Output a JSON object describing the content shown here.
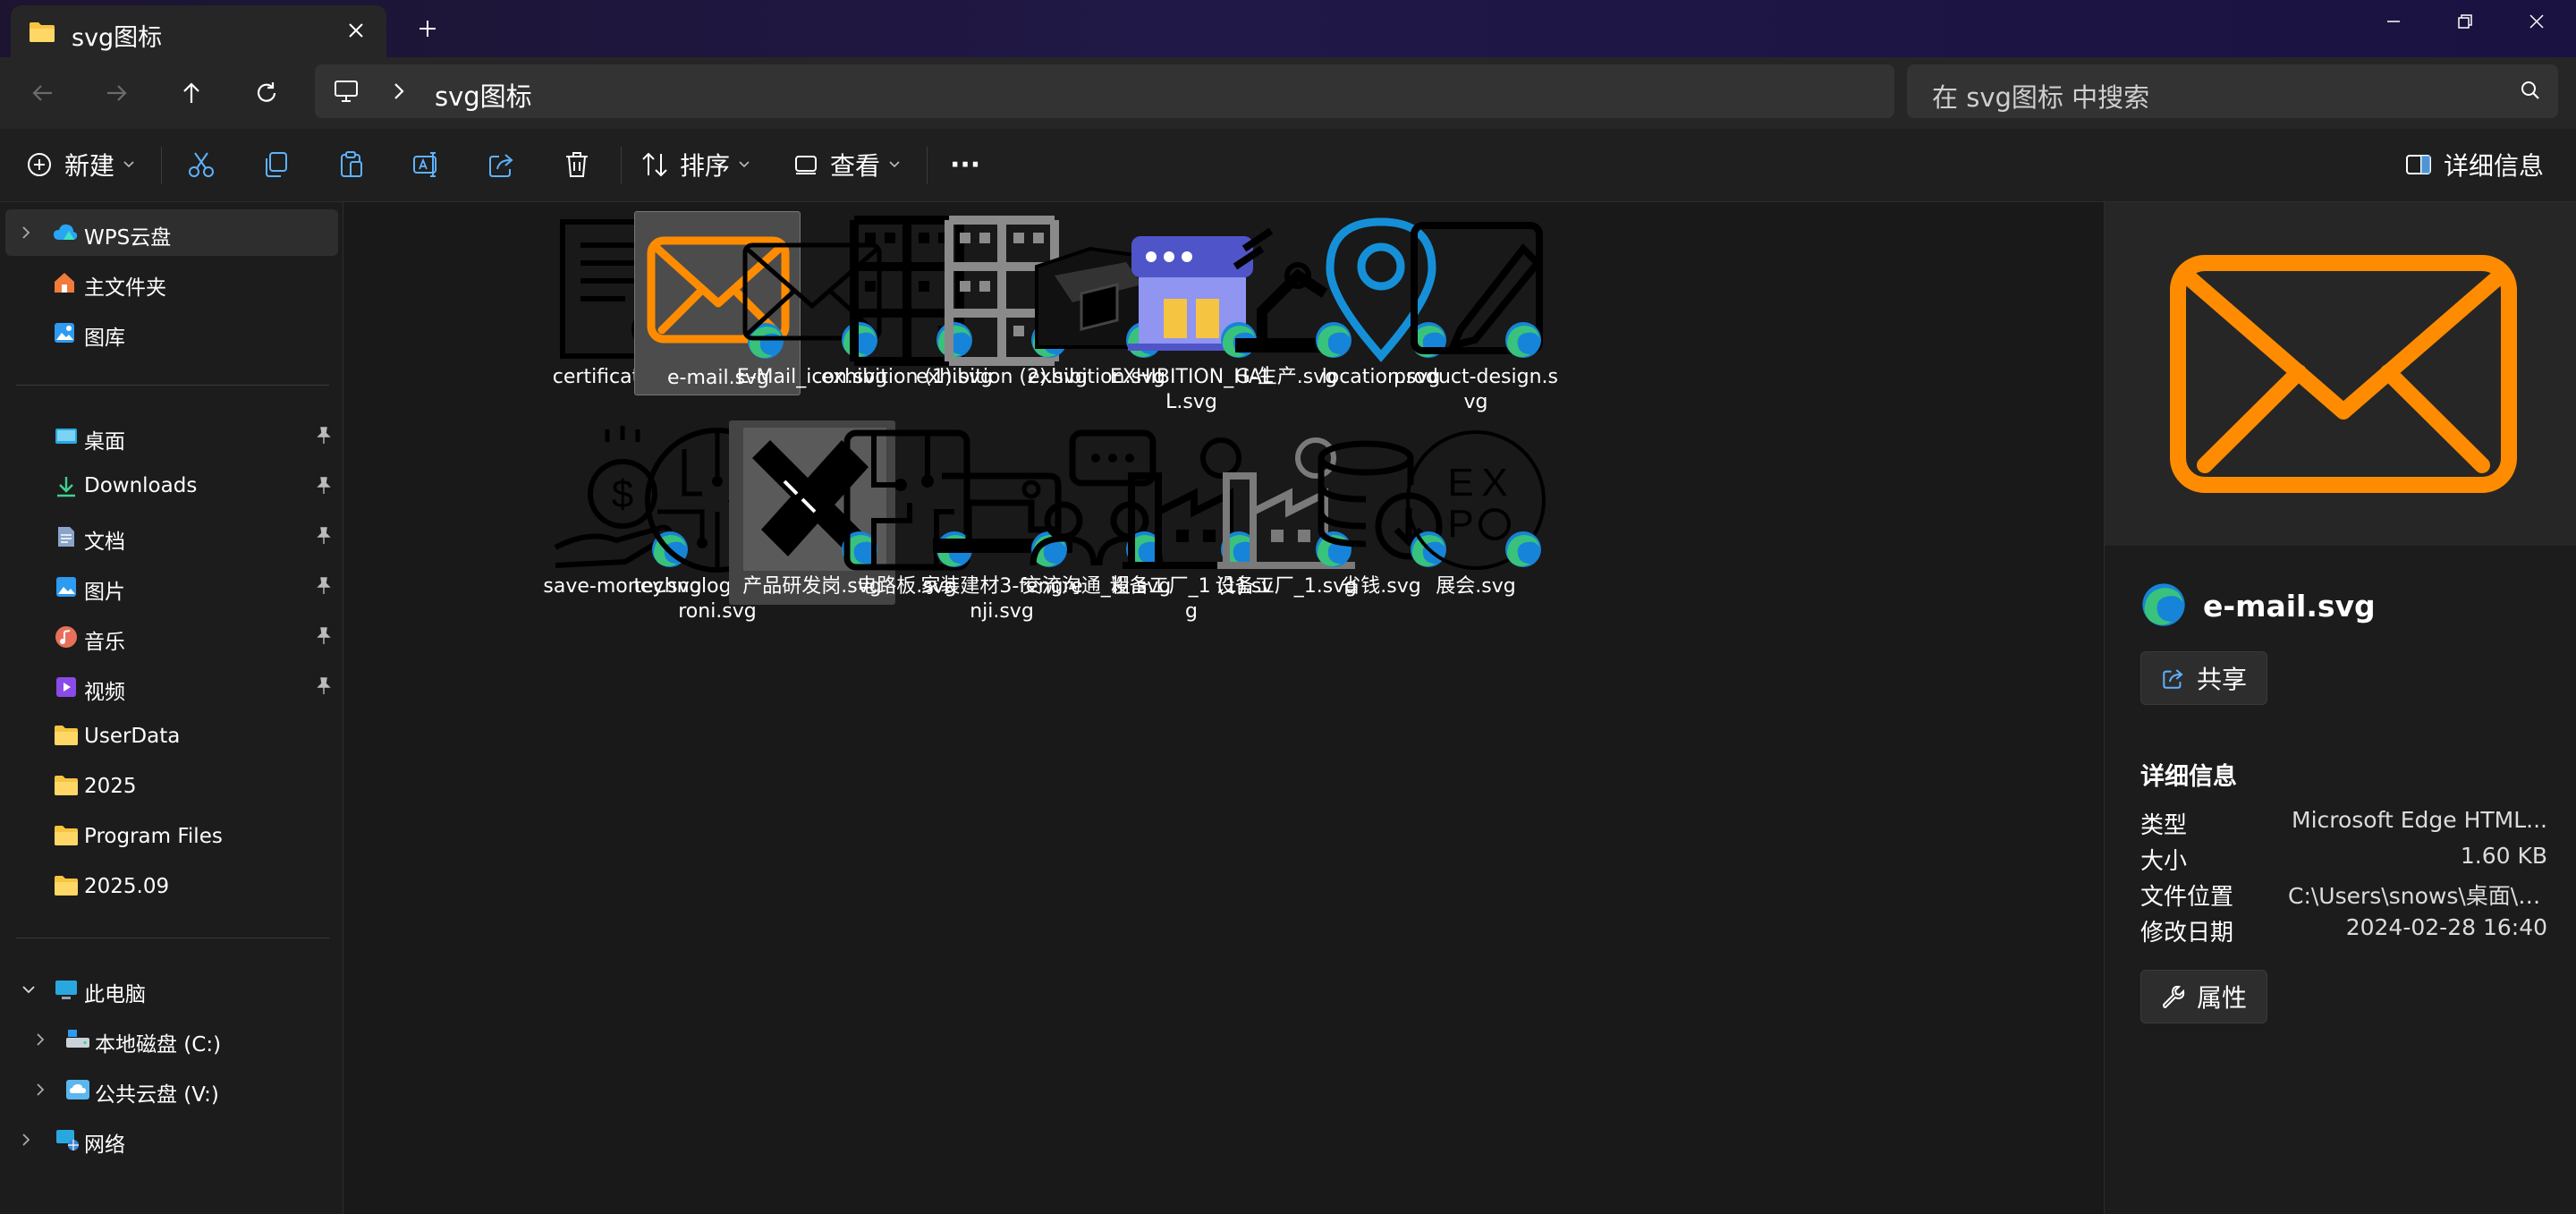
{
  "window": {
    "tab_title": "svg图标",
    "colors": {
      "accent": "#ff8c00",
      "edge_blue": "#1684d8",
      "edge_green": "#39c27c",
      "selection": "#4c4c4c"
    }
  },
  "address": {
    "breadcrumb": "svg图标",
    "search_placeholder": "在 svg图标 中搜索"
  },
  "commands": {
    "new_label": "新建",
    "sort_label": "排序",
    "view_label": "查看",
    "more_label": "···",
    "details_label": "详细信息"
  },
  "sidebar": {
    "top": [
      {
        "label": "WPS云盘",
        "icon": "cloud-icon"
      },
      {
        "label": "主文件夹",
        "icon": "home-icon"
      },
      {
        "label": "图库",
        "icon": "gallery-icon"
      }
    ],
    "quick": [
      {
        "label": "桌面",
        "icon": "desktop-icon",
        "pinned": true
      },
      {
        "label": "Downloads",
        "icon": "download-icon",
        "pinned": true
      },
      {
        "label": "文档",
        "icon": "document-icon",
        "pinned": true
      },
      {
        "label": "图片",
        "icon": "pictures-icon",
        "pinned": true
      },
      {
        "label": "音乐",
        "icon": "music-icon",
        "pinned": true
      },
      {
        "label": "视频",
        "icon": "video-icon",
        "pinned": true
      },
      {
        "label": "UserData",
        "icon": "folder-icon",
        "pinned": false
      },
      {
        "label": "2025",
        "icon": "folder-icon",
        "pinned": false
      },
      {
        "label": "Program Files",
        "icon": "folder-icon",
        "pinned": false
      },
      {
        "label": "2025.09",
        "icon": "folder-icon",
        "pinned": false
      }
    ],
    "devices": [
      {
        "label": "此电脑",
        "icon": "pc-icon"
      },
      {
        "label": "本地磁盘 (C:)",
        "icon": "drive-icon"
      },
      {
        "label": "公共云盘 (V:)",
        "icon": "cloud-drive-icon"
      },
      {
        "label": "网络",
        "icon": "network-icon"
      }
    ]
  },
  "files": [
    {
      "name": "certificate.svg",
      "icon": "certificate-icon"
    },
    {
      "name": "e-mail.svg",
      "icon": "email-orange-icon",
      "selected": true
    },
    {
      "name": "E-Mail_icon.svg",
      "icon": "email-outline-icon"
    },
    {
      "name": "exhibition (1).svg",
      "icon": "shelf-icon"
    },
    {
      "name": "exhibition (2).svg",
      "icon": "shelf-gray-icon"
    },
    {
      "name": "exhibition.svg",
      "icon": "exhibition-booth-icon"
    },
    {
      "name": "EXHIBITION_HALL.svg",
      "icon": "exhibition-hall-icon"
    },
    {
      "name": "G-生产.svg",
      "icon": "robot-arm-icon"
    },
    {
      "name": "location.svg",
      "icon": "location-pin-icon"
    },
    {
      "name": "product-design.svg",
      "icon": "product-design-icon"
    },
    {
      "name": "save-money.svg",
      "icon": "save-money-icon"
    },
    {
      "name": "technology_electroni.svg",
      "icon": "circuit-circle-icon"
    },
    {
      "name": "产品研发岗.svg",
      "icon": "tools-icon",
      "hovered": true
    },
    {
      "name": "电路板.svg",
      "icon": "circuit-board-icon"
    },
    {
      "name": "家装建材3-fengrenji.svg",
      "icon": "sewing-machine-icon"
    },
    {
      "name": "交流沟通_粗.svg",
      "icon": "communication-icon"
    },
    {
      "name": "设备工厂_1 (1).svg",
      "icon": "factory-icon"
    },
    {
      "name": "设备工厂_1.svg",
      "icon": "factory-gray-icon"
    },
    {
      "name": "省钱.svg",
      "icon": "coins-download-icon"
    },
    {
      "name": "展会.svg",
      "icon": "expo-icon"
    }
  ],
  "details": {
    "name": "e-mail.svg",
    "share_label": "共享",
    "section_title": "详细信息",
    "properties_label": "属性",
    "rows": [
      {
        "key": "类型",
        "value": "Microsoft Edge HTML..."
      },
      {
        "key": "大小",
        "value": "1.60 KB"
      },
      {
        "key": "文件位置",
        "value": "C:\\Users\\snows\\桌面\\s..."
      },
      {
        "key": "修改日期",
        "value": "2024-02-28 16:40"
      }
    ]
  }
}
